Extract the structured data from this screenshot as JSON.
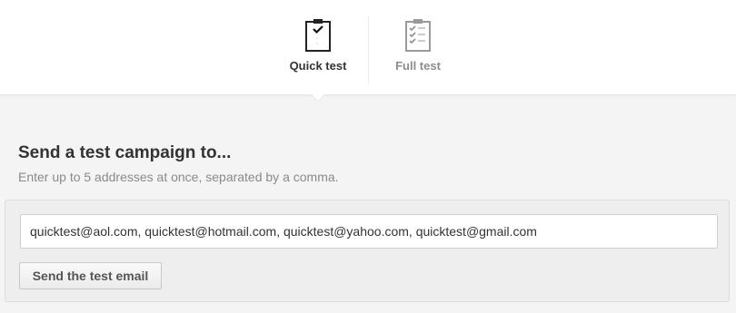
{
  "tabs": {
    "quick": {
      "label": "Quick test",
      "icon": "clipboard-single-check-icon",
      "active": true
    },
    "full": {
      "label": "Full test",
      "icon": "clipboard-checklist-icon",
      "active": false
    }
  },
  "section": {
    "heading": "Send a test campaign to...",
    "subtext": "Enter up to 5 addresses at once, separated by a comma."
  },
  "form": {
    "email_value": "quicktest@aol.com, quicktest@hotmail.com, quicktest@yahoo.com, quicktest@gmail.com",
    "send_label": "Send the test email"
  },
  "colors": {
    "active_tab_text": "#333333",
    "inactive_tab_text": "#8c8c8c",
    "page_background": "#f4f4f4"
  }
}
